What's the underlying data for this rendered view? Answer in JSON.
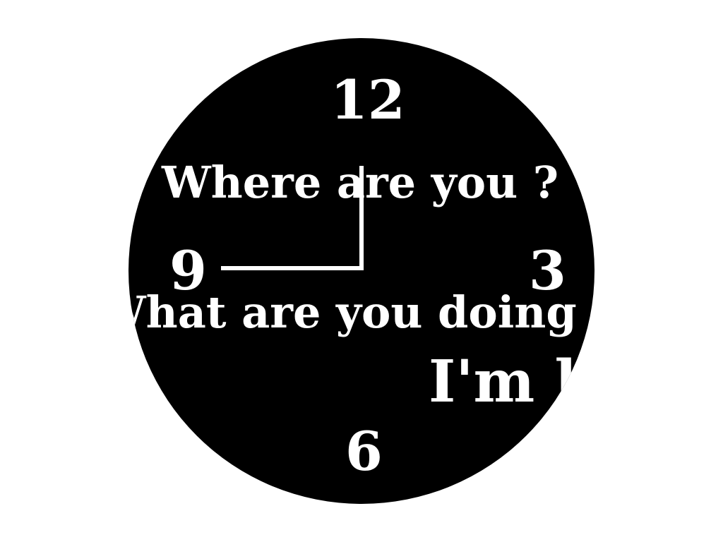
{
  "clock": {
    "numerals": {
      "twelve": "12",
      "three": "3",
      "six": "6",
      "nine": "9"
    },
    "phrases": {
      "where": "Where are you ?",
      "doing": "What are you doing ?",
      "im": "I'm here"
    },
    "time_shown": "9:00",
    "colors": {
      "face": "#000000",
      "ink": "#ffffff",
      "background": "#ffffff"
    }
  }
}
